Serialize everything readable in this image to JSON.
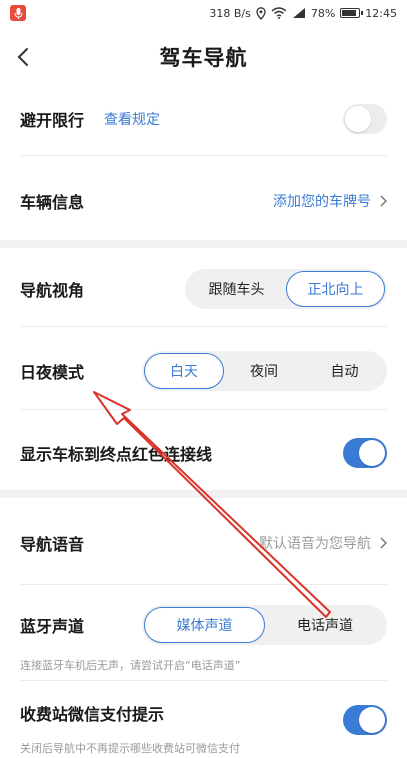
{
  "status_bar": {
    "speed": "318",
    "speed_unit": "B/s",
    "battery": "78%",
    "time": "12:45",
    "battery_level": 0.78
  },
  "header": {
    "title": "驾车导航",
    "back_icon": "chevron-left-icon"
  },
  "settings": {
    "avoid_restriction": {
      "label": "避开限行",
      "link": "查看规定",
      "enabled": false
    },
    "vehicle_info": {
      "label": "车辆信息",
      "value": "添加您的车牌号"
    },
    "nav_view": {
      "label": "导航视角",
      "options": [
        "跟随车头",
        "正北向上"
      ],
      "selected": 1
    },
    "day_night": {
      "label": "日夜模式",
      "options": [
        "白天",
        "夜间",
        "自动"
      ],
      "selected": 0
    },
    "show_line": {
      "label": "显示车标到终点红色连接线",
      "enabled": true
    },
    "nav_voice": {
      "label": "导航语音",
      "value": "默认语音为您导航"
    },
    "bt_channel": {
      "label": "蓝牙声道",
      "options": [
        "媒体声道",
        "电话声道"
      ],
      "selected": 0,
      "hint": "连接蓝牙车机后无声，请尝试开启“电话声道”"
    },
    "toll_wechat": {
      "label": "收费站微信支付提示",
      "enabled": true,
      "hint": "关闭后导航中不再提示哪些收费站可微信支付"
    }
  },
  "colors": {
    "accent": "#3a7bd5",
    "annotation_arrow": "#d9342b"
  }
}
